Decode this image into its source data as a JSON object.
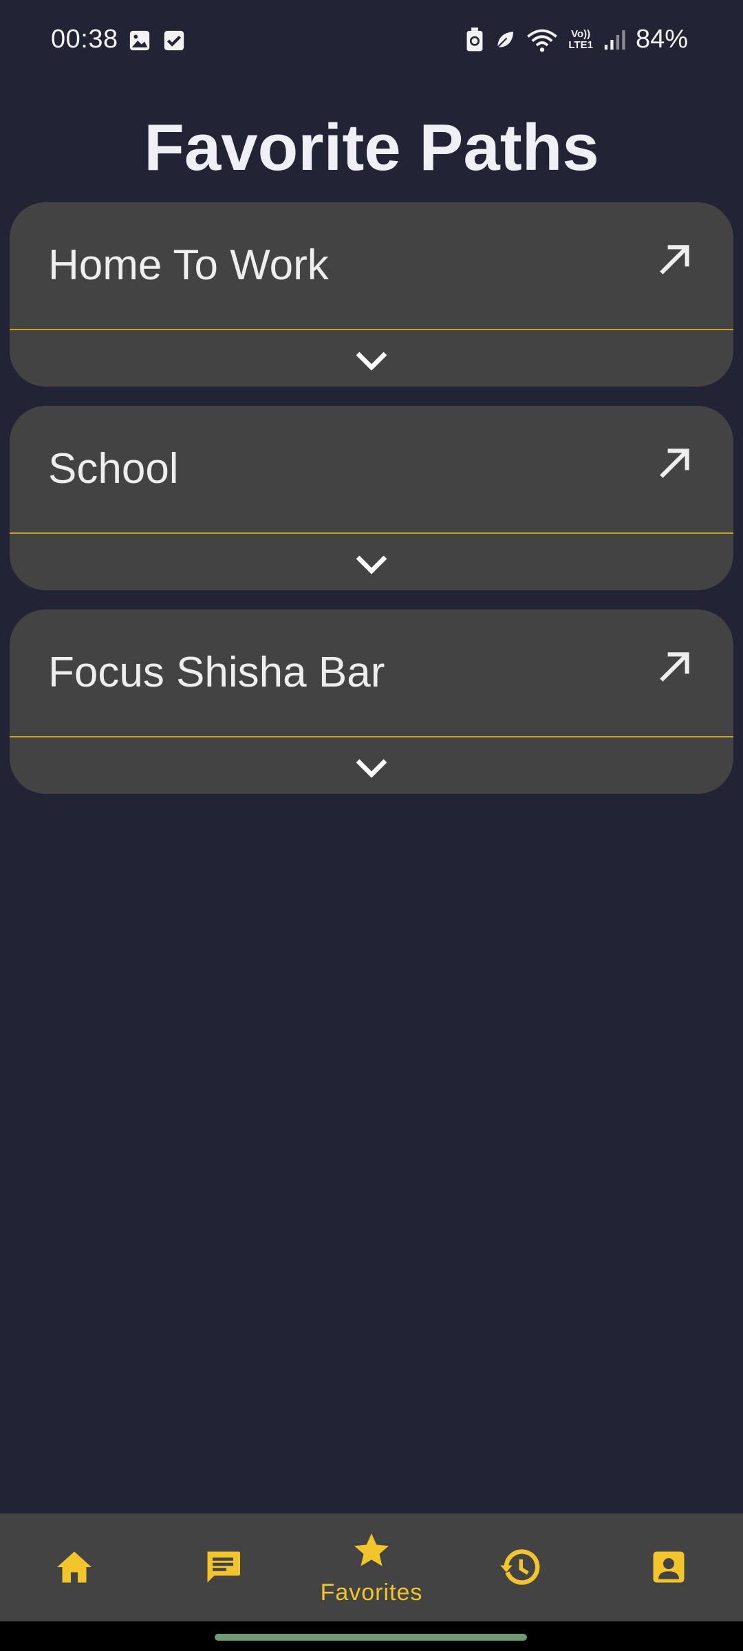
{
  "status_bar": {
    "time": "00:38",
    "lte_line1": "Vo))",
    "lte_line2": "LTE1",
    "battery": "84%",
    "icons": [
      "image-icon",
      "checkbox-icon",
      "battery-saver-icon",
      "leaf-icon",
      "wifi-icon",
      "signal-icon"
    ]
  },
  "page": {
    "title": "Favorite Paths"
  },
  "favorites": [
    {
      "label": "Home To Work"
    },
    {
      "label": "School"
    },
    {
      "label": "Focus Shisha Bar"
    }
  ],
  "bottom_nav": {
    "items": [
      {
        "icon": "home-icon",
        "label": ""
      },
      {
        "icon": "message-icon",
        "label": ""
      },
      {
        "icon": "star-icon",
        "label": "Favorites",
        "active": true
      },
      {
        "icon": "history-icon",
        "label": ""
      },
      {
        "icon": "profile-icon",
        "label": ""
      }
    ]
  },
  "colors": {
    "background": "#222335",
    "card": "#434343",
    "accent": "#f2c52d",
    "divider": "#c9a327",
    "text": "#eeeeee"
  }
}
